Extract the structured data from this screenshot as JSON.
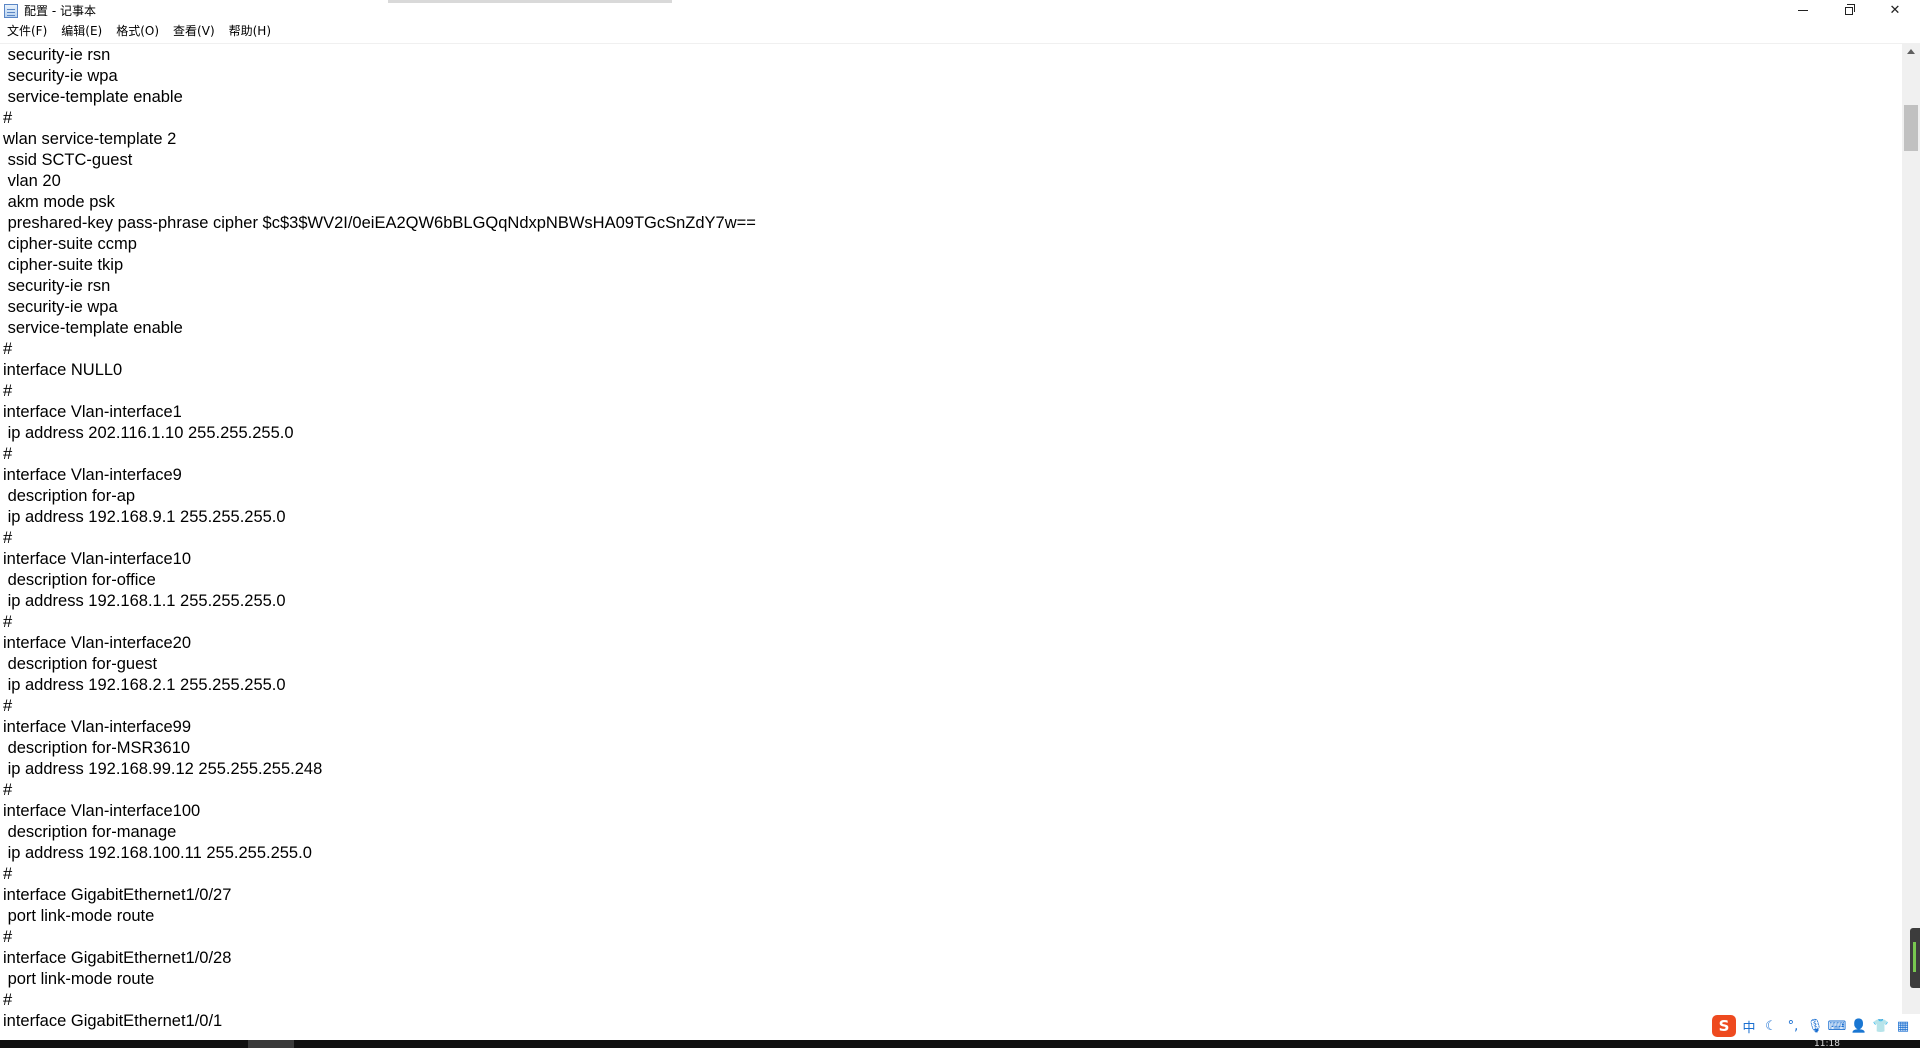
{
  "window": {
    "title": "配置 - 记事本"
  },
  "menu": [
    {
      "label": "文件(F)"
    },
    {
      "label": "编辑(E)"
    },
    {
      "label": "格式(O)"
    },
    {
      "label": "查看(V)"
    },
    {
      "label": "帮助(H)"
    }
  ],
  "editor": {
    "lines": [
      " security-ie rsn",
      " security-ie wpa",
      " service-template enable",
      "#",
      "wlan service-template 2",
      " ssid SCTC-guest",
      " vlan 20",
      " akm mode psk",
      " preshared-key pass-phrase cipher $c$3$WV2I/0eiEA2QW6bBLGQqNdxpNBWsHA09TGcSnZdY7w==",
      " cipher-suite ccmp",
      " cipher-suite tkip",
      " security-ie rsn",
      " security-ie wpa",
      " service-template enable",
      "#",
      "interface NULL0",
      "#",
      "interface Vlan-interface1",
      " ip address 202.116.1.10 255.255.255.0",
      "#",
      "interface Vlan-interface9",
      " description for-ap",
      " ip address 192.168.9.1 255.255.255.0",
      "#",
      "interface Vlan-interface10",
      " description for-office",
      " ip address 192.168.1.1 255.255.255.0",
      "#",
      "interface Vlan-interface20",
      " description for-guest",
      " ip address 192.168.2.1 255.255.255.0",
      "#",
      "interface Vlan-interface99",
      " description for-MSR3610",
      " ip address 192.168.99.12 255.255.255.248",
      "#",
      "interface Vlan-interface100",
      " description for-manage",
      " ip address 192.168.100.11 255.255.255.0",
      "#",
      "interface GigabitEthernet1/0/27",
      " port link-mode route",
      "#",
      "interface GigabitEthernet1/0/28",
      " port link-mode route",
      "#",
      "interface GigabitEthernet1/0/1"
    ]
  },
  "tray": {
    "ime_logo": "S",
    "ime_mode": "中",
    "icons": [
      "moon-icon",
      "punctuation-icon",
      "microphone-icon",
      "keyboard-icon",
      "user-icon",
      "shirt-icon",
      "grid-icon"
    ]
  },
  "taskbar": {
    "clock": "11:18"
  }
}
